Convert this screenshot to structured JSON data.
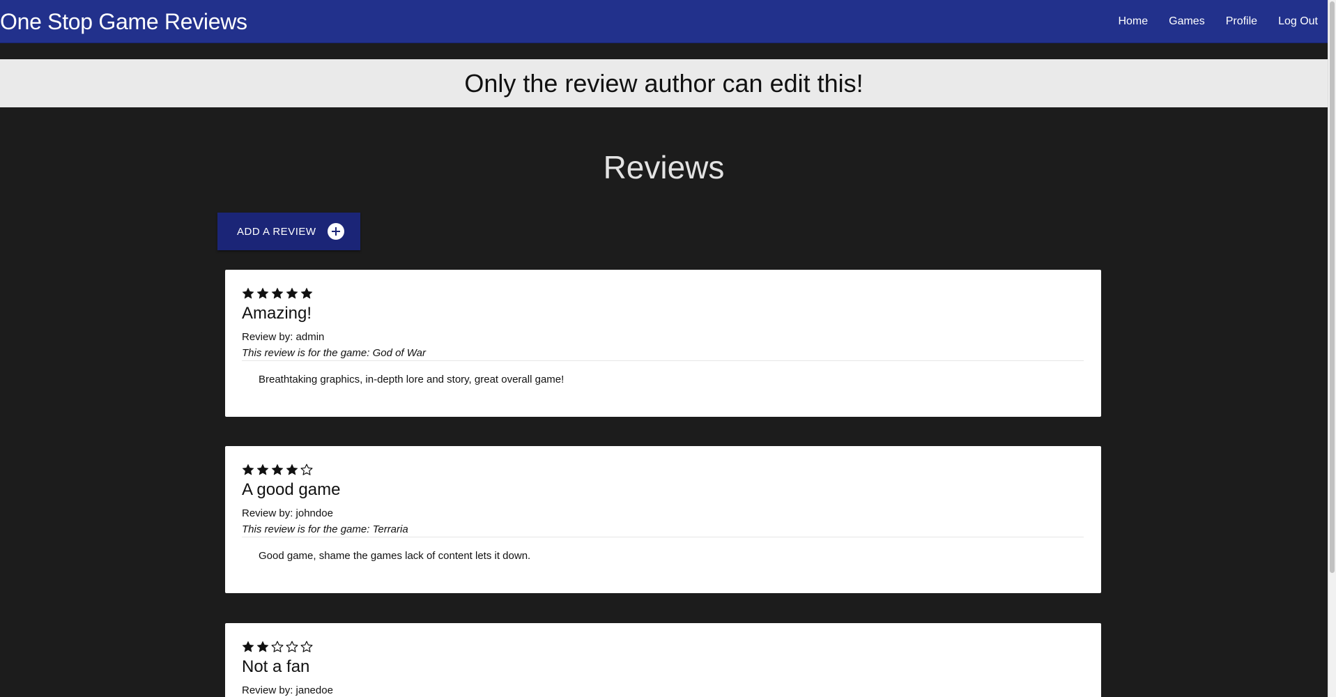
{
  "navbar": {
    "brand": "One Stop Game Reviews",
    "links": [
      {
        "label": "Home"
      },
      {
        "label": "Games"
      },
      {
        "label": "Profile"
      },
      {
        "label": "Log Out"
      }
    ],
    "background_color": "#22318c"
  },
  "alert": {
    "message": "Only the review author can edit this!"
  },
  "main": {
    "heading": "Reviews",
    "add_button": {
      "label": "ADD A REVIEW",
      "icon": "plus-circle-icon"
    },
    "reviews": [
      {
        "rating": 5,
        "max_rating": 5,
        "title": "Amazing!",
        "author_line": "Review by: admin",
        "game_line": "This review is for the game: God of War",
        "body": "Breathtaking graphics, in-depth lore and story, great overall game!"
      },
      {
        "rating": 4,
        "max_rating": 5,
        "title": "A good game",
        "author_line": "Review by: johndoe",
        "game_line": "This review is for the game: Terraria",
        "body": "Good game, shame the games lack of content lets it down."
      },
      {
        "rating": 2,
        "max_rating": 5,
        "title": "Not a fan",
        "author_line": "Review by: janedoe",
        "game_line": "",
        "body": ""
      }
    ]
  },
  "colors": {
    "page_background": "#1c1c1c",
    "button_background": "#1b2577",
    "card_background": "#ffffff"
  }
}
